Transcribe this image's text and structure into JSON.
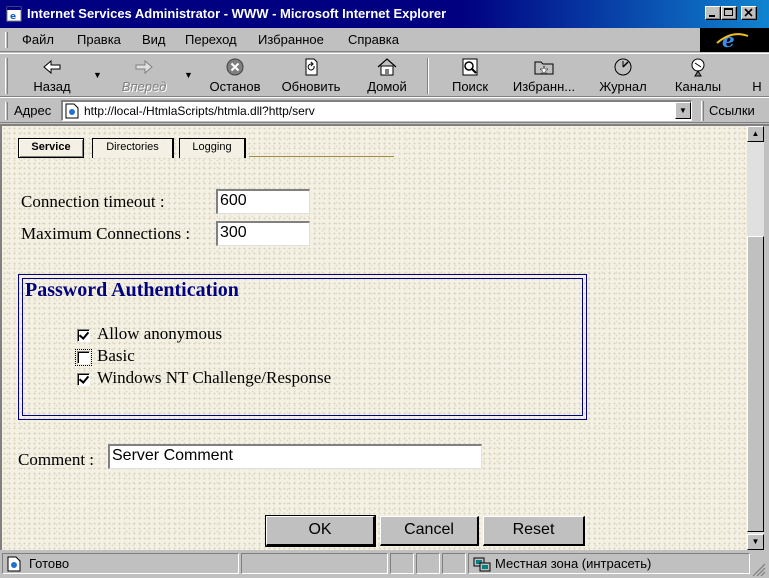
{
  "window": {
    "title": "Internet Services Administrator - WWW - Microsoft Internet Explorer"
  },
  "menu": [
    "Файл",
    "Правка",
    "Вид",
    "Переход",
    "Избранное",
    "Справка"
  ],
  "toolbar": {
    "back": "Назад",
    "forward": "Вперед",
    "stop": "Останов",
    "refresh": "Обновить",
    "home": "Домой",
    "search": "Поиск",
    "favorites": "Избранн...",
    "history": "Журнал",
    "channels": "Каналы",
    "more": "Н"
  },
  "address": {
    "label": "Адрес",
    "url": "http://local-/HtmlaScripts/htmla.dll?http/serv",
    "links": "Ссылки"
  },
  "tabs": [
    {
      "label": "Service",
      "active": true
    },
    {
      "label": "Directories",
      "active": false
    },
    {
      "label": "Logging",
      "active": false
    }
  ],
  "form": {
    "connection_timeout_label": "Connection timeout :",
    "connection_timeout_value": "600",
    "max_connections_label": "Maximum Connections :",
    "max_connections_value": "300",
    "auth": {
      "title": "Password Authentication",
      "options": [
        {
          "label": "Allow anonymous",
          "checked": true
        },
        {
          "label": "Basic",
          "checked": false
        },
        {
          "label": "Windows NT Challenge/Response",
          "checked": true
        }
      ]
    },
    "comment_label": "Comment :",
    "comment_value": "Server Comment",
    "buttons": {
      "ok": "OK",
      "cancel": "Cancel",
      "reset": "Reset"
    }
  },
  "status": {
    "text": "Готово",
    "zone": "Местная зона (интрасеть)"
  },
  "colors": {
    "titlebar": "#000080",
    "auth_heading": "#000080",
    "page_background": "#f4f1e4"
  }
}
